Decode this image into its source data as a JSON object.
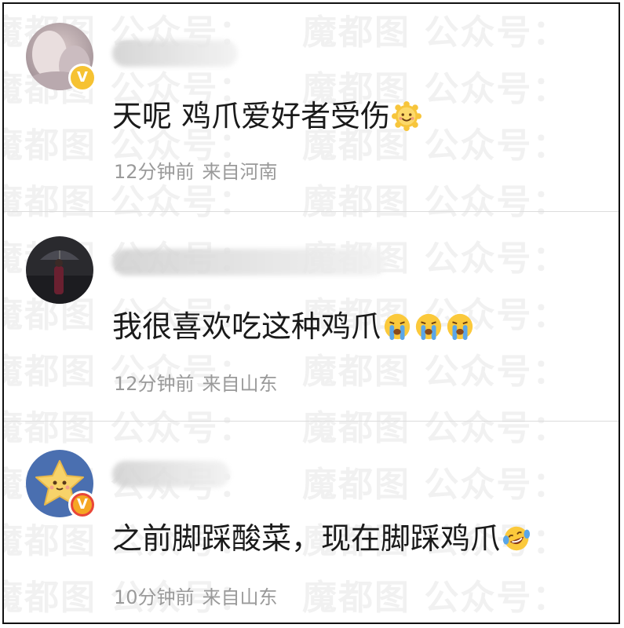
{
  "watermark": "魔都图 公众号：",
  "comments": [
    {
      "text": "天呢 鸡爪爱好者受伤",
      "emoji": [
        "sun-smile-icon"
      ],
      "time": "12分钟前",
      "location": "来自河南",
      "verified": true,
      "username_blurred": true
    },
    {
      "text": "我很喜欢吃这种鸡爪",
      "emoji": [
        "crying-face-icon",
        "crying-face-icon",
        "crying-face-icon"
      ],
      "time": "12分钟前",
      "location": "来自山东",
      "verified": false,
      "username_blurred": true
    },
    {
      "text": "之前脚踩酸菜，现在脚踩鸡爪",
      "emoji": [
        "laughing-tears-icon"
      ],
      "time": "10分钟前",
      "location": "来自山东",
      "verified": true,
      "username_blurred": true
    }
  ],
  "colors": {
    "text": "#1a1a1a",
    "meta": "#9a9a9a",
    "badge": "#f6c232",
    "divider": "#dcdcdc"
  }
}
